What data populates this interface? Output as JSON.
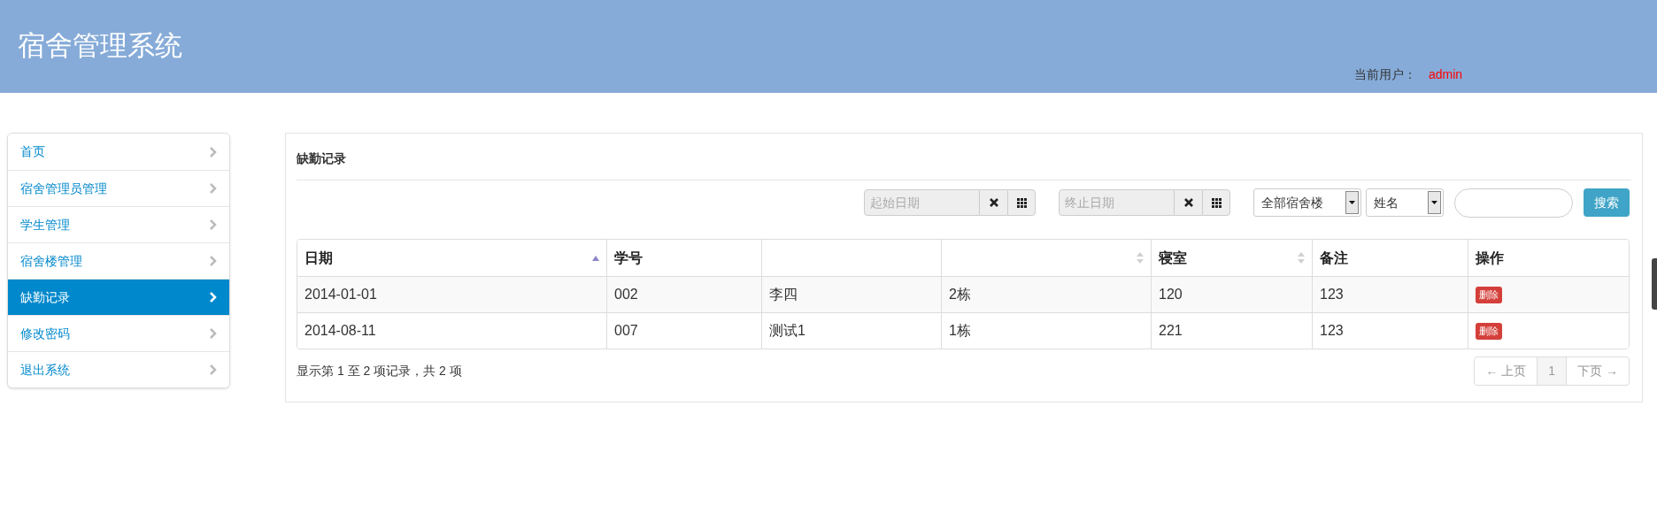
{
  "header": {
    "title": "宿舍管理系统",
    "user_label": "当前用户：",
    "user_name": "admin"
  },
  "sidebar": {
    "items": [
      {
        "label": "首页",
        "selected": false
      },
      {
        "label": "宿舍管理员管理",
        "selected": false
      },
      {
        "label": "学生管理",
        "selected": false
      },
      {
        "label": "宿舍楼管理",
        "selected": false
      },
      {
        "label": "缺勤记录",
        "selected": true
      },
      {
        "label": "修改密码",
        "selected": false
      },
      {
        "label": "退出系统",
        "selected": false
      }
    ]
  },
  "panel": {
    "title": "缺勤记录",
    "filters": {
      "start_date": {
        "placeholder": "起始日期"
      },
      "end_date": {
        "placeholder": "终止日期"
      },
      "building": {
        "value": "全部宿舍楼"
      },
      "field": {
        "value": "姓名"
      },
      "search_button": "搜索"
    },
    "table": {
      "columns": [
        {
          "label": "日期",
          "kind": "ascending"
        },
        {
          "label": "学号",
          "kind": "plain"
        },
        {
          "kind": "plain"
        },
        {
          "kind": "sortable"
        },
        {
          "label": "寝室",
          "kind": "sortable"
        },
        {
          "label": "备注",
          "kind": "plain"
        },
        {
          "label": "操作",
          "kind": "plain"
        }
      ],
      "rows": [
        [
          "2014-01-01",
          "002",
          "李四",
          "2栋",
          "120",
          "123",
          "删除"
        ],
        [
          "2014-08-11",
          "007",
          "测试1",
          "1栋",
          "221",
          "123",
          "删除"
        ]
      ]
    },
    "info": "显示第 1 至 2 项记录，共 2 项",
    "pagination": {
      "prev": "← 上页",
      "page": "1",
      "next": "下页 →"
    }
  }
}
